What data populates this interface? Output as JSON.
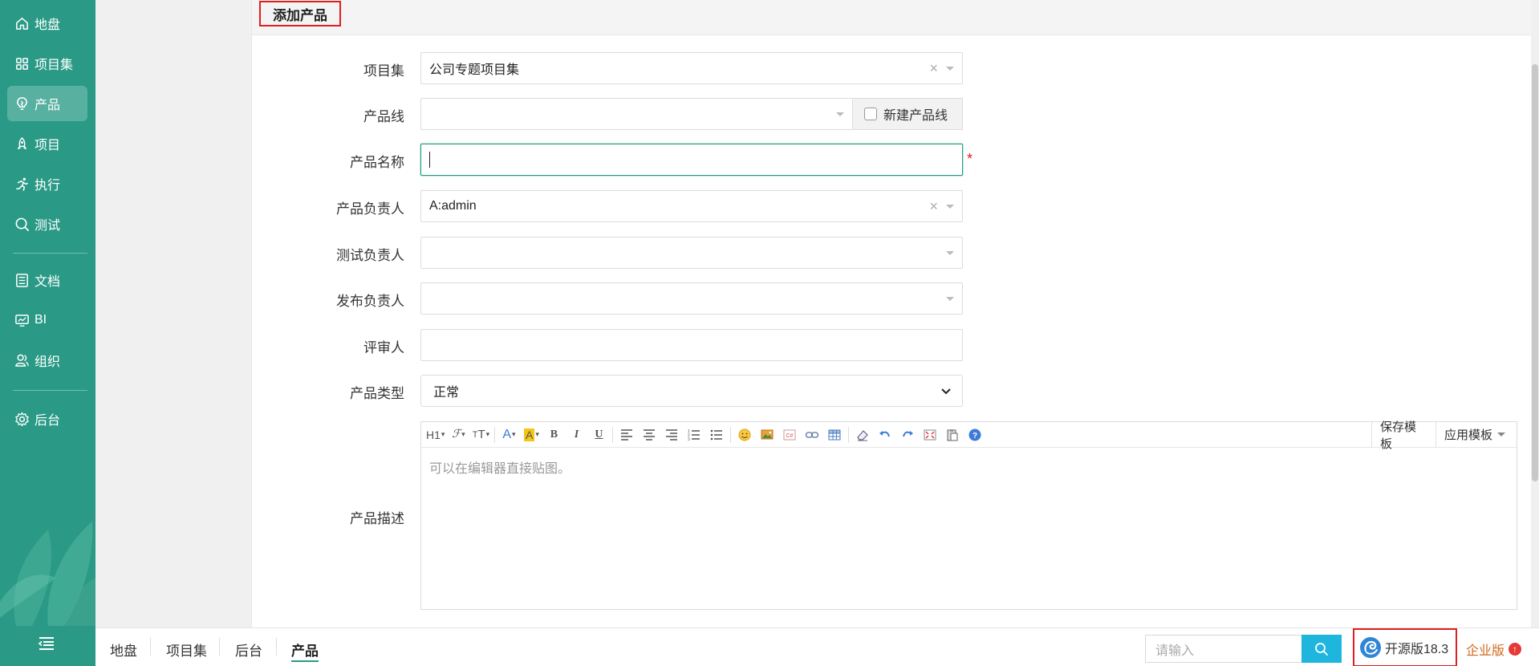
{
  "sidebar": {
    "items": [
      {
        "label": "地盘",
        "icon": "home-icon"
      },
      {
        "label": "项目集",
        "icon": "grid-icon"
      },
      {
        "label": "产品",
        "icon": "lightbulb-icon"
      },
      {
        "label": "项目",
        "icon": "rocket-icon"
      },
      {
        "label": "执行",
        "icon": "run-icon"
      },
      {
        "label": "测试",
        "icon": "magnifier-icon"
      },
      {
        "label": "文档",
        "icon": "list-icon"
      },
      {
        "label": "BI",
        "icon": "monitor-icon"
      },
      {
        "label": "组织",
        "icon": "people-icon"
      },
      {
        "label": "后台",
        "icon": "gear-icon"
      }
    ],
    "active": "产品",
    "accent": "#2a9a86"
  },
  "page": {
    "title": "添加产品"
  },
  "form": {
    "program": {
      "label": "项目集",
      "value": "公司专题项目集"
    },
    "line": {
      "label": "产品线",
      "value": "",
      "new_line_label": "新建产品线"
    },
    "name": {
      "label": "产品名称",
      "value": "",
      "required_mark": "*"
    },
    "po": {
      "label": "产品负责人",
      "value": "A:admin"
    },
    "qd": {
      "label": "测试负责人",
      "value": ""
    },
    "rd": {
      "label": "发布负责人",
      "value": ""
    },
    "reviewer": {
      "label": "评审人",
      "value": ""
    },
    "type": {
      "label": "产品类型",
      "value": "正常"
    },
    "desc": {
      "label": "产品描述",
      "placeholder": "可以在编辑器直接贴图。",
      "toolbar": {
        "h1": "H1",
        "save_template": "保存模板",
        "apply_template": "应用模板"
      }
    }
  },
  "footer": {
    "breadcrumbs": [
      "地盘",
      "项目集",
      "后台",
      "产品"
    ],
    "search_placeholder": "请输入",
    "version": "开源版18.3",
    "enterprise": "企业版"
  }
}
